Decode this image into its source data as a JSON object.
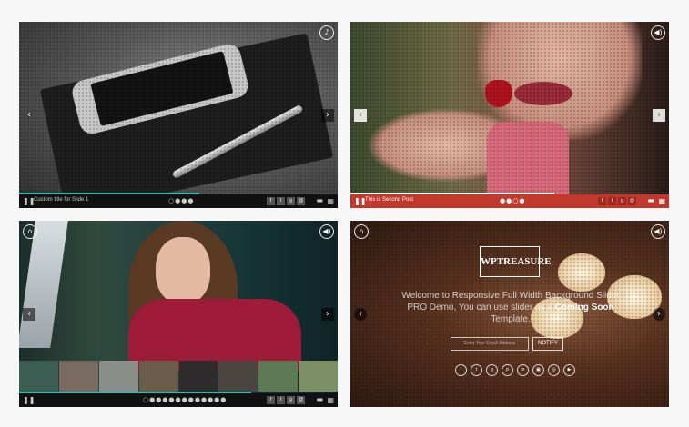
{
  "colors": {
    "teal": "#2bbbad",
    "red": "#c0392b",
    "page_bg": "#f7f7f7"
  },
  "slider1": {
    "caption": "Custom title for Slide 1",
    "pager": "○●●●",
    "social": [
      "f",
      "t",
      "g",
      "@"
    ],
    "icons": {
      "pause": "pause-icon",
      "grid": "grid-icon",
      "top": "sound-icon"
    }
  },
  "slider2": {
    "caption": "This is Second Post",
    "pager": "●●○●",
    "social": [
      "f",
      "t",
      "g",
      "@"
    ]
  },
  "slider3": {
    "pager": "○●●●●●●●●●●●●",
    "social": [
      "f",
      "t",
      "g",
      "@"
    ],
    "thumbnail_count": 10
  },
  "slider4": {
    "logo_text": "WPTREASURE",
    "welcome_line1": "Welcome to Responsive Full Width Background Slider",
    "welcome_line2": "PRO Demo, You can use slider as a",
    "welcome_highlight": "Coming Soon",
    "welcome_line3": "Template.",
    "email_placeholder": "Enter Your Email Address",
    "notify_label": "NOTIFY",
    "social_circles": [
      "f",
      "t",
      "g",
      "p",
      "in",
      "▣",
      "◎",
      "▶"
    ]
  }
}
